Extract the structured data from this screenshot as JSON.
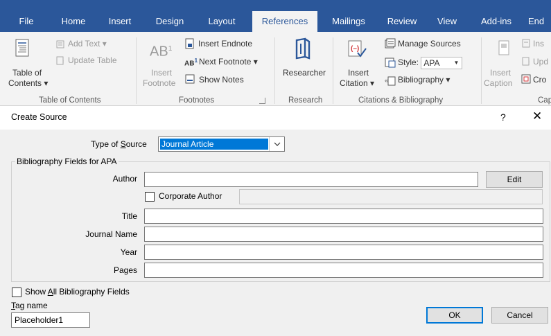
{
  "ribbon": {
    "tabs": [
      {
        "label": "File",
        "active": false
      },
      {
        "label": "Home",
        "active": false
      },
      {
        "label": "Insert",
        "active": false
      },
      {
        "label": "Design",
        "active": false
      },
      {
        "label": "Layout",
        "active": false
      },
      {
        "label": "References",
        "active": true
      },
      {
        "label": "Mailings",
        "active": false
      },
      {
        "label": "Review",
        "active": false
      },
      {
        "label": "View",
        "active": false
      },
      {
        "label": "Add-ins",
        "active": false
      },
      {
        "label": "End",
        "active": false
      }
    ],
    "toc_group": {
      "table_of_contents_line1": "Table of",
      "table_of_contents_line2": "Contents ▾",
      "add_text": "Add Text ▾",
      "update_table": "Update Table",
      "label": "Table of Contents"
    },
    "footnotes_group": {
      "insert_footnote_line1": "Insert",
      "insert_footnote_line2": "Footnote",
      "ab_glyph": "AB",
      "ab_sup": "1",
      "insert_endnote": "Insert Endnote",
      "next_footnote": "Next Footnote ▾",
      "show_notes": "Show Notes",
      "label": "Footnotes"
    },
    "research_group": {
      "researcher": "Researcher",
      "label": "Research"
    },
    "citations_group": {
      "insert_citation_line1": "Insert",
      "insert_citation_line2": "Citation ▾",
      "manage_sources": "Manage Sources",
      "style_label": "Style:",
      "style_value": "APA",
      "bibliography": "Bibliography ▾",
      "label": "Citations & Bibliography"
    },
    "captions_group": {
      "insert_caption_line1": "Insert",
      "insert_caption_line2": "Caption",
      "insert_table_of_figures": "Ins",
      "update_table": "Upd",
      "cross_reference": "Cro",
      "label": "Cap"
    }
  },
  "dialog": {
    "title": "Create Source",
    "help": "?",
    "close": "✕",
    "type_of_source_label_pre": "Type of ",
    "type_of_source_label_key": "S",
    "type_of_source_label_post": "ource",
    "type_of_source_value": "Journal Article",
    "bibliography_fields_legend": "Bibliography Fields for APA",
    "fields": {
      "author_label": "Author",
      "author_value": "",
      "edit_button": "Edit",
      "corporate_author_label": "Corporate Author",
      "corporate_author_checked": false,
      "title_label": "Title",
      "title_value": "",
      "journal_name_label": "Journal Name",
      "journal_name_value": "",
      "year_label": "Year",
      "year_value": "",
      "pages_label": "Pages",
      "pages_value": ""
    },
    "show_all_pre": "Show ",
    "show_all_key": "A",
    "show_all_post": "ll Bibliography Fields",
    "show_all_checked": false,
    "tag_name_key": "T",
    "tag_name_post": "ag name",
    "tag_name_value": "Placeholder1",
    "ok_button": "OK",
    "cancel_button": "Cancel"
  }
}
